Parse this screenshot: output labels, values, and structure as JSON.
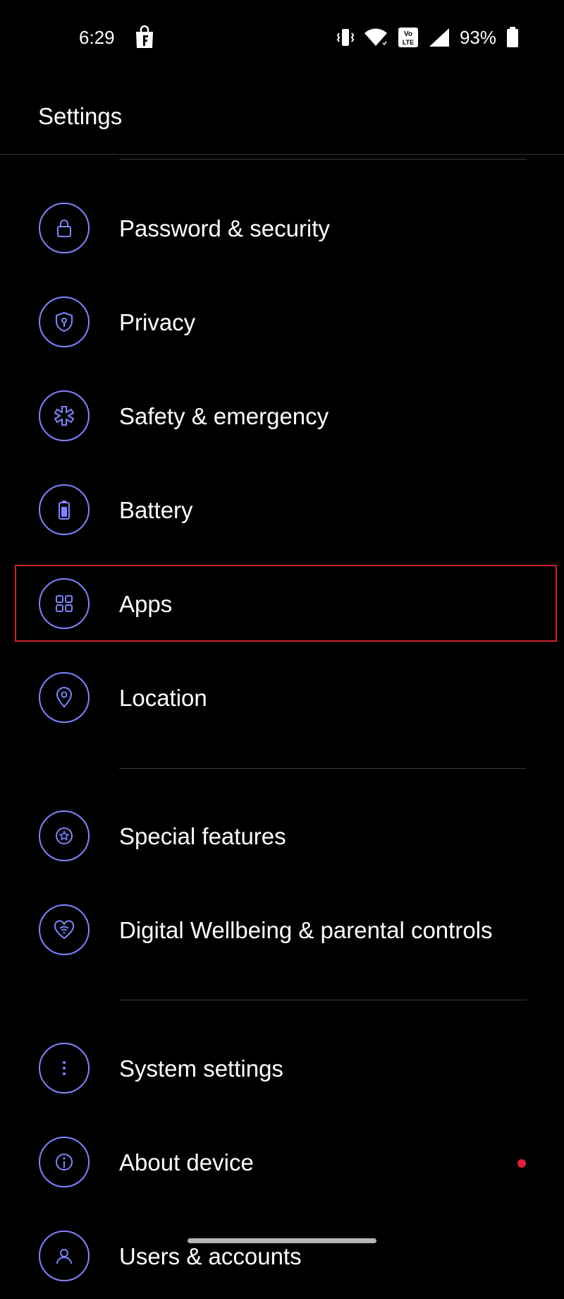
{
  "status_bar": {
    "time": "6:29",
    "battery_percent": "93%",
    "icons": [
      "shopping-bag-f-icon",
      "vibrate-icon",
      "wifi-icon",
      "volte-icon",
      "signal-icon",
      "battery-icon"
    ]
  },
  "header": {
    "title": "Settings"
  },
  "items": [
    {
      "label": "Password & security",
      "icon": "lock-icon"
    },
    {
      "label": "Privacy",
      "icon": "shield-icon"
    },
    {
      "label": "Safety & emergency",
      "icon": "medical-star-icon"
    },
    {
      "label": "Battery",
      "icon": "battery-icon"
    },
    {
      "label": "Apps",
      "icon": "apps-grid-icon"
    },
    {
      "label": "Location",
      "icon": "location-pin-icon"
    },
    {
      "label": "Special features",
      "icon": "star-icon"
    },
    {
      "label": "Digital Wellbeing & parental controls",
      "icon": "heart-wifi-icon"
    },
    {
      "label": "System settings",
      "icon": "more-vertical-icon"
    },
    {
      "label": "About device",
      "icon": "info-icon"
    },
    {
      "label": "Users & accounts",
      "icon": "user-icon"
    }
  ],
  "colors": {
    "background": "#000000",
    "accent": "#7f84ff",
    "highlight": "#d12431",
    "notification": "#e0203a"
  }
}
